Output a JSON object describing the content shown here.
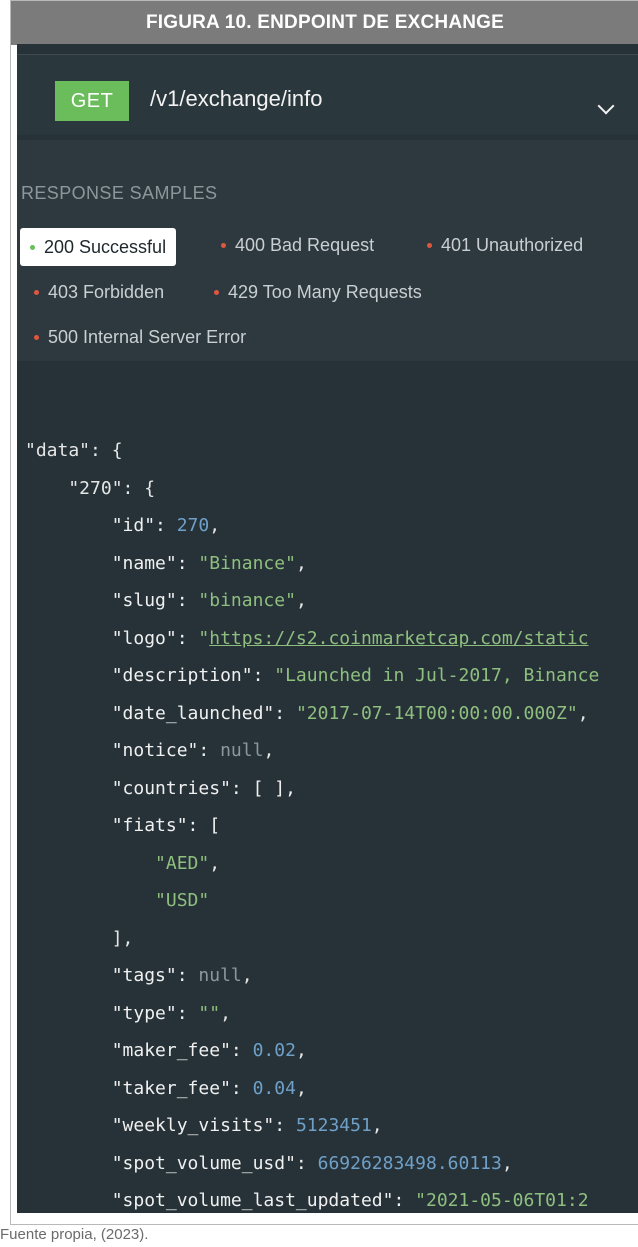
{
  "figure": {
    "title": "FIGURA 10. ENDPOINT DE EXCHANGE",
    "caption": "Fuente propia, (2023)."
  },
  "endpoint": {
    "method": "GET",
    "path": "/v1/exchange/info",
    "method_color": "#6bbd5b"
  },
  "response_samples": {
    "heading": "RESPONSE SAMPLES",
    "tabs": [
      {
        "label": "200 Successful",
        "status": "success",
        "selected": true,
        "dot_color": "#6bbd5b"
      },
      {
        "label": "400 Bad Request",
        "status": "error",
        "selected": false,
        "dot_color": "#e0573f"
      },
      {
        "label": "401 Unauthorized",
        "status": "error",
        "selected": false,
        "dot_color": "#e0573f"
      },
      {
        "label": "403 Forbidden",
        "status": "error",
        "selected": false,
        "dot_color": "#e0573f"
      },
      {
        "label": "429 Too Many Requests",
        "status": "error",
        "selected": false,
        "dot_color": "#e0573f"
      },
      {
        "label": "500 Internal Server Error",
        "status": "error",
        "selected": false,
        "dot_color": "#e0573f"
      }
    ]
  },
  "code": {
    "lines": [
      [
        "\"data\": {"
      ],
      [
        "    \"270\": {"
      ],
      [
        "        \"id\": ",
        "270",
        ","
      ],
      [
        "        \"name\": ",
        "\"Binance\"",
        ","
      ],
      [
        "        \"slug\": ",
        "\"binance\"",
        ","
      ],
      [
        "        \"logo\": ",
        "\"",
        "https://s2.coinmarketcap.com/static"
      ],
      [
        "        \"description\": ",
        "\"Launched in Jul-2017, Binance"
      ],
      [
        "        \"date_launched\": ",
        "\"2017-07-14T00:00:00.000Z\"",
        ","
      ],
      [
        "        \"notice\": ",
        "null",
        ","
      ],
      [
        "        \"countries\": [ ],"
      ],
      [
        "        \"fiats\": ["
      ],
      [
        "            ",
        "\"AED\"",
        ","
      ],
      [
        "            ",
        "\"USD\""
      ],
      [
        "        ],"
      ],
      [
        "        \"tags\": ",
        "null",
        ","
      ],
      [
        "        \"type\": ",
        "\"\"",
        ","
      ],
      [
        "        \"maker_fee\": ",
        "0.02",
        ","
      ],
      [
        "        \"taker_fee\": ",
        "0.04",
        ","
      ],
      [
        "        \"weekly_visits\": ",
        "5123451",
        ","
      ],
      [
        "        \"spot_volume_usd\": ",
        "66926283498.60113",
        ","
      ],
      [
        "        \"spot_volume_last_updated\": ",
        "\"2021-05-06T01:2"
      ]
    ]
  }
}
